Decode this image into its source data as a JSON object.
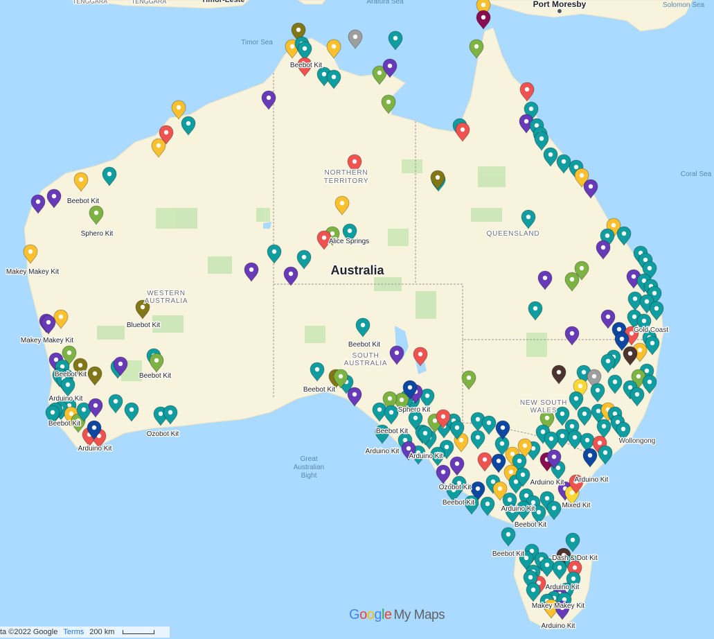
{
  "map": {
    "colors": {
      "water": "#aadaff",
      "land": "#f7f3dd",
      "park": "#c8e6b4",
      "border": "#a0a0a0"
    },
    "country_label": "Australia",
    "region_labels": [
      {
        "text": "NORTHERN",
        "kind": "state"
      },
      {
        "text": "TERRITORY",
        "kind": "state"
      },
      {
        "text": "QUEENSLAND",
        "kind": "state"
      },
      {
        "text": "WESTERN",
        "kind": "state"
      },
      {
        "text": "AUSTRALIA",
        "kind": "state"
      },
      {
        "text": "SOUTH",
        "kind": "state"
      },
      {
        "text": "AUSTRALIA",
        "kind": "state"
      },
      {
        "text": "NEW SOUTH",
        "kind": "state"
      },
      {
        "text": "WALES",
        "kind": "state"
      }
    ],
    "water_labels": [
      "Timor Sea",
      "Arafura Sea",
      "Coral Sea",
      "Solomon Sea",
      "Great",
      "Australian",
      "Bight"
    ],
    "place_labels": [
      "Port Moresby",
      "TENGGARA",
      "TENGGARA",
      "Timor-Leste",
      "Wollongong",
      "Gold Coast"
    ],
    "kit_labels": [
      "Beebot Kit",
      "Beebot Kit",
      "Sphero Kit",
      "Makey Makey Kit",
      "Bluebot Kit",
      "Makey Makey Kit",
      "Beebot Kit",
      "Arduino Kit",
      "Beebot Kit",
      "Arduino Kit",
      "Ozobot Kit",
      "Beebot Kit",
      "Beebot Kit",
      "Beebot Kit",
      "Sphero Kit",
      "Beebot Kit",
      "Arduino Kit",
      "Arduino Kit",
      "Ozobot Kit",
      "Beebot Kit",
      "Arduino Kit",
      "Arduino Kit",
      "Beebot Kit",
      "Mixed Kit",
      "Arduino Kit",
      "Beebot Kit",
      "Dash & Dot Kit",
      "Arduino Kit",
      "Makey Makey Kit",
      "Arduino Kit",
      "Alice Springs"
    ],
    "marker_colors": [
      "#0f9d9f",
      "#673ab7",
      "#fbc02d",
      "#ef5350",
      "#7cb342",
      "#827717",
      "#0d47a1",
      "#880e4f",
      "#4e342e",
      "#9e9e9e",
      "#fdd835"
    ],
    "marker_count": 320
  },
  "footer": {
    "copyright": "ta ©2022 Google",
    "terms": "Terms",
    "scale": "200 km"
  },
  "logo": {
    "g": "G",
    "o1": "o",
    "o2": "o",
    "g2": "g",
    "l": "l",
    "e": "e",
    "product": "My Maps"
  }
}
